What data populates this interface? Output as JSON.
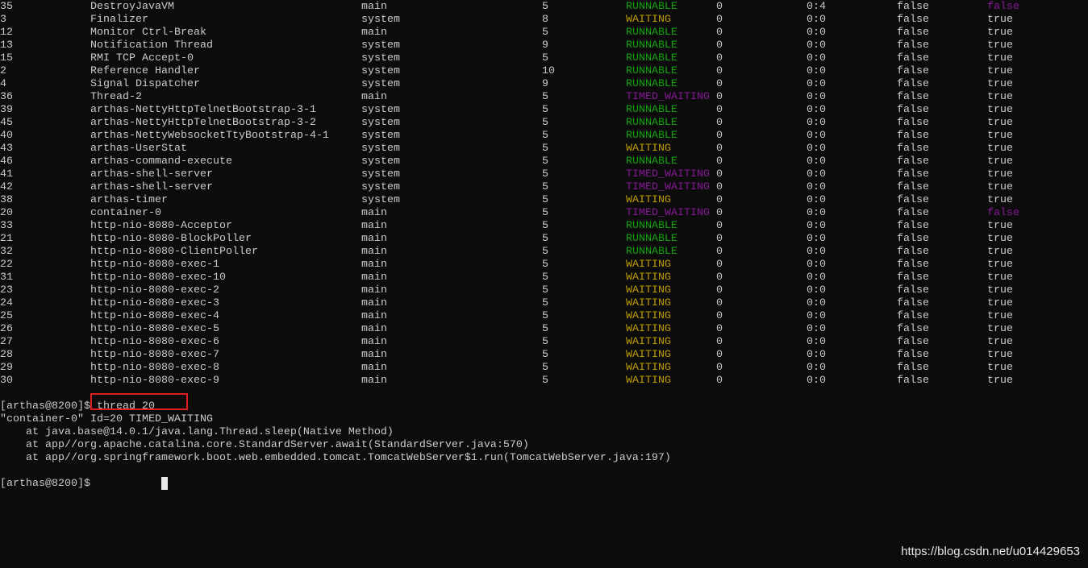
{
  "colors": {
    "background": "#0c0c0c",
    "text": "#cccccc",
    "RUNNABLE": "#13a10e",
    "WAITING": "#c19c00",
    "TIMED_WAITING": "#881798",
    "daemon_false": "#881798",
    "highlight_box": "#e02020"
  },
  "threads": [
    [
      "35",
      "DestroyJavaVM",
      "main",
      "5",
      "RUNNABLE",
      "0",
      "0:4",
      "false",
      "false"
    ],
    [
      "3",
      "Finalizer",
      "system",
      "8",
      "WAITING",
      "0",
      "0:0",
      "false",
      "true"
    ],
    [
      "12",
      "Monitor Ctrl-Break",
      "main",
      "5",
      "RUNNABLE",
      "0",
      "0:0",
      "false",
      "true"
    ],
    [
      "13",
      "Notification Thread",
      "system",
      "9",
      "RUNNABLE",
      "0",
      "0:0",
      "false",
      "true"
    ],
    [
      "15",
      "RMI TCP Accept-0",
      "system",
      "5",
      "RUNNABLE",
      "0",
      "0:0",
      "false",
      "true"
    ],
    [
      "2",
      "Reference Handler",
      "system",
      "10",
      "RUNNABLE",
      "0",
      "0:0",
      "false",
      "true"
    ],
    [
      "4",
      "Signal Dispatcher",
      "system",
      "9",
      "RUNNABLE",
      "0",
      "0:0",
      "false",
      "true"
    ],
    [
      "36",
      "Thread-2",
      "main",
      "5",
      "TIMED_WAITING",
      "0",
      "0:0",
      "false",
      "true"
    ],
    [
      "39",
      "arthas-NettyHttpTelnetBootstrap-3-1",
      "system",
      "5",
      "RUNNABLE",
      "0",
      "0:0",
      "false",
      "true"
    ],
    [
      "45",
      "arthas-NettyHttpTelnetBootstrap-3-2",
      "system",
      "5",
      "RUNNABLE",
      "0",
      "0:0",
      "false",
      "true"
    ],
    [
      "40",
      "arthas-NettyWebsocketTtyBootstrap-4-1",
      "system",
      "5",
      "RUNNABLE",
      "0",
      "0:0",
      "false",
      "true"
    ],
    [
      "43",
      "arthas-UserStat",
      "system",
      "5",
      "WAITING",
      "0",
      "0:0",
      "false",
      "true"
    ],
    [
      "46",
      "arthas-command-execute",
      "system",
      "5",
      "RUNNABLE",
      "0",
      "0:0",
      "false",
      "true"
    ],
    [
      "41",
      "arthas-shell-server",
      "system",
      "5",
      "TIMED_WAITING",
      "0",
      "0:0",
      "false",
      "true"
    ],
    [
      "42",
      "arthas-shell-server",
      "system",
      "5",
      "TIMED_WAITING",
      "0",
      "0:0",
      "false",
      "true"
    ],
    [
      "38",
      "arthas-timer",
      "system",
      "5",
      "WAITING",
      "0",
      "0:0",
      "false",
      "true"
    ],
    [
      "20",
      "container-0",
      "main",
      "5",
      "TIMED_WAITING",
      "0",
      "0:0",
      "false",
      "false"
    ],
    [
      "33",
      "http-nio-8080-Acceptor",
      "main",
      "5",
      "RUNNABLE",
      "0",
      "0:0",
      "false",
      "true"
    ],
    [
      "21",
      "http-nio-8080-BlockPoller",
      "main",
      "5",
      "RUNNABLE",
      "0",
      "0:0",
      "false",
      "true"
    ],
    [
      "32",
      "http-nio-8080-ClientPoller",
      "main",
      "5",
      "RUNNABLE",
      "0",
      "0:0",
      "false",
      "true"
    ],
    [
      "22",
      "http-nio-8080-exec-1",
      "main",
      "5",
      "WAITING",
      "0",
      "0:0",
      "false",
      "true"
    ],
    [
      "31",
      "http-nio-8080-exec-10",
      "main",
      "5",
      "WAITING",
      "0",
      "0:0",
      "false",
      "true"
    ],
    [
      "23",
      "http-nio-8080-exec-2",
      "main",
      "5",
      "WAITING",
      "0",
      "0:0",
      "false",
      "true"
    ],
    [
      "24",
      "http-nio-8080-exec-3",
      "main",
      "5",
      "WAITING",
      "0",
      "0:0",
      "false",
      "true"
    ],
    [
      "25",
      "http-nio-8080-exec-4",
      "main",
      "5",
      "WAITING",
      "0",
      "0:0",
      "false",
      "true"
    ],
    [
      "26",
      "http-nio-8080-exec-5",
      "main",
      "5",
      "WAITING",
      "0",
      "0:0",
      "false",
      "true"
    ],
    [
      "27",
      "http-nio-8080-exec-6",
      "main",
      "5",
      "WAITING",
      "0",
      "0:0",
      "false",
      "true"
    ],
    [
      "28",
      "http-nio-8080-exec-7",
      "main",
      "5",
      "WAITING",
      "0",
      "0:0",
      "false",
      "true"
    ],
    [
      "29",
      "http-nio-8080-exec-8",
      "main",
      "5",
      "WAITING",
      "0",
      "0:0",
      "false",
      "true"
    ],
    [
      "30",
      "http-nio-8080-exec-9",
      "main",
      "5",
      "WAITING",
      "0",
      "0:0",
      "false",
      "true"
    ]
  ],
  "session": {
    "prompt": "[arthas@8200]$",
    "command": " thread 20",
    "output": [
      "\"container-0\" Id=20 TIMED_WAITING",
      "    at java.base@14.0.1/java.lang.Thread.sleep(Native Method)",
      "    at app//org.apache.catalina.core.StandardServer.await(StandardServer.java:570)",
      "    at app//org.springframework.boot.web.embedded.tomcat.TomcatWebServer$1.run(TomcatWebServer.java:197)"
    ],
    "prompt2": "[arthas@8200]$"
  },
  "watermark": "https://blog.csdn.net/u014429653"
}
